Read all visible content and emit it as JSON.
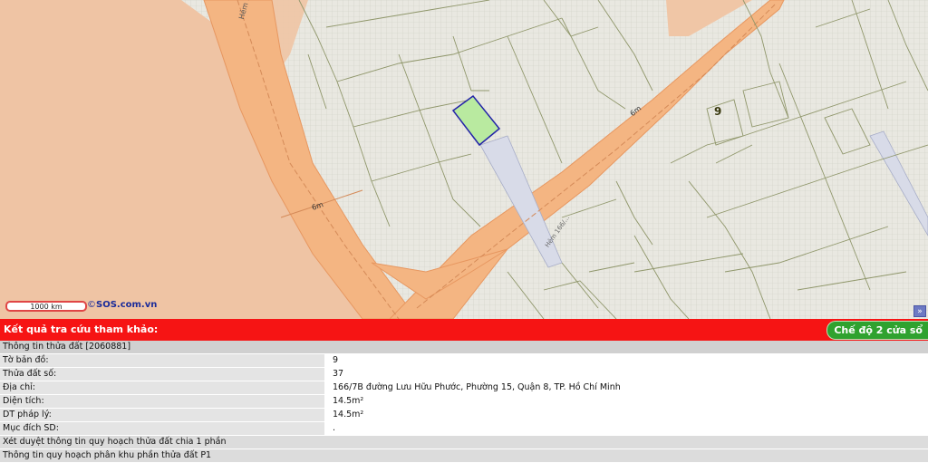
{
  "map": {
    "parcel_number": "9",
    "road_labels": [
      "6m",
      "6m",
      "Hẻm 166/1 Lưu",
      "Hẻm 166/..."
    ],
    "scale_label": "1000 km",
    "credit_symbol": "©",
    "credit_text": "SOS.com.vn",
    "expand_glyph": "»",
    "colors": {
      "ground": "#e9e8e1",
      "plot_lines": "#8f966a",
      "road": "#f4b582",
      "road_edge": "#e79760",
      "open_land": "#efc4a4",
      "selected_fill": "#b9eaa0",
      "selected_stroke": "#2323a8"
    }
  },
  "result": {
    "title": "Kết quả tra cứu tham khảo:",
    "mode_button": "Chế độ 2 cửa sổ"
  },
  "info": {
    "header": "Thông tin thửa đất [2060881]",
    "rows": [
      {
        "label": "Tờ bản đồ:",
        "value": "9"
      },
      {
        "label": "Thửa đất số:",
        "value": "37"
      },
      {
        "label": "Địa chỉ:",
        "value": "166/7B đường Lưu Hữu Phước, Phường 15, Quận 8, TP. Hồ Chí Minh"
      },
      {
        "label": "Diện tích:",
        "value": "14.5m²"
      },
      {
        "label": "DT pháp lý:",
        "value": "14.5m²"
      },
      {
        "label": "Mục đích SD:",
        "value": "."
      }
    ],
    "footer1": "Xét duyệt thông tin quy hoạch thửa đất chia 1 phần",
    "footer2": "Thông tin quy hoạch phân khu phần thửa đất P1"
  }
}
